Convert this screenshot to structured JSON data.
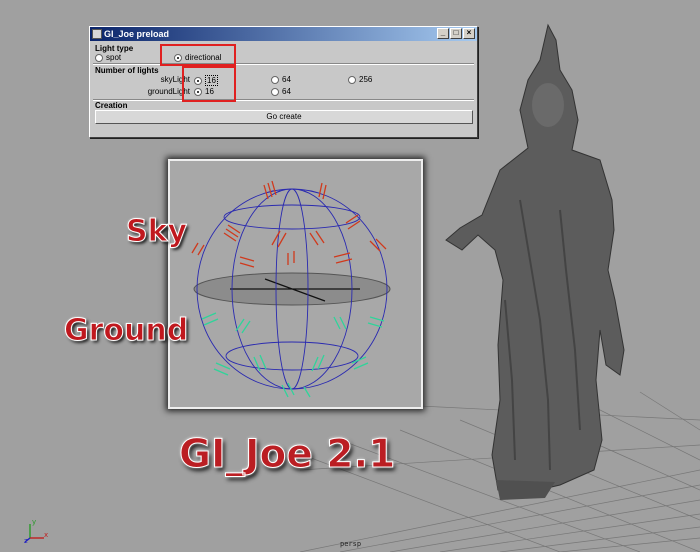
{
  "window": {
    "title": "GI_Joe preload",
    "buttons": {
      "minimize": "_",
      "maximize": "□",
      "close": "×"
    }
  },
  "light_type": {
    "heading": "Light type",
    "options": [
      {
        "label": "spot",
        "selected": false
      },
      {
        "label": "directional",
        "selected": true
      }
    ]
  },
  "number_of_lights": {
    "heading": "Number of lights",
    "rows": [
      {
        "label": "skyLight",
        "options": [
          "16",
          "64",
          "256"
        ],
        "selected": "16"
      },
      {
        "label": "groundLight",
        "options": [
          "16",
          "64"
        ],
        "selected": "16"
      }
    ]
  },
  "creation": {
    "heading": "Creation",
    "button": "Go create"
  },
  "labels": {
    "sky": "Sky",
    "ground": "Ground",
    "title": "GI_Joe 2.1"
  },
  "viewport": {
    "camera": "persp",
    "axis": {
      "x": "x",
      "y": "y",
      "z": "z"
    }
  },
  "colors": {
    "highlight": "#e02020",
    "sky_lights": "#d0391c",
    "ground_lights": "#2fd49a",
    "sphere_wire": "#2a2ab0"
  }
}
